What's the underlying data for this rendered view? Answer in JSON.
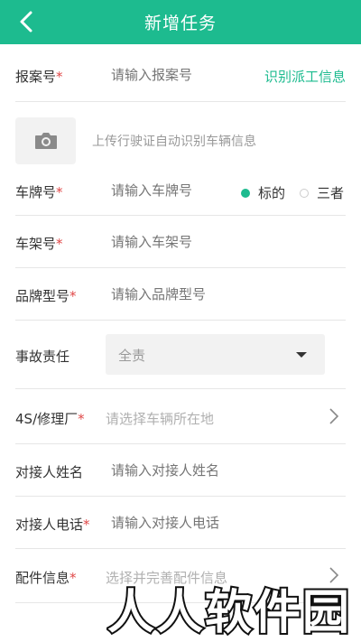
{
  "header": {
    "title": "新增任务"
  },
  "form": {
    "report_no": {
      "label": "报案号",
      "required": "*",
      "placeholder": "请输入报案号",
      "action": "识别派工信息"
    },
    "upload": {
      "hint": "上传行驶证自动识别车辆信息",
      "icon": "camera-icon"
    },
    "plate": {
      "label": "车牌号",
      "required": "*",
      "placeholder": "请输入车牌号",
      "options": [
        {
          "label": "标的",
          "selected": true
        },
        {
          "label": "三者",
          "selected": false
        }
      ]
    },
    "vin": {
      "label": "车架号",
      "required": "*",
      "placeholder": "请输入车架号"
    },
    "model": {
      "label": "品牌型号",
      "required": "*",
      "placeholder": "请输入品牌型号"
    },
    "liability": {
      "label": "事故责任",
      "value": "全责"
    },
    "shop": {
      "label": "4S/修理厂",
      "required": "*",
      "placeholder": "请选择车辆所在地"
    },
    "contact_name": {
      "label": "对接人姓名",
      "placeholder": "请输入对接人姓名"
    },
    "contact_phone": {
      "label": "对接人电话",
      "required": "*",
      "placeholder": "请输入对接人电话"
    },
    "parts": {
      "label": "配件信息",
      "required": "*",
      "placeholder": "选择并完善配件信息"
    }
  },
  "watermark": {
    "text": "人人软件园"
  },
  "colors": {
    "accent": "#1dbb8f",
    "required": "#e04848"
  }
}
